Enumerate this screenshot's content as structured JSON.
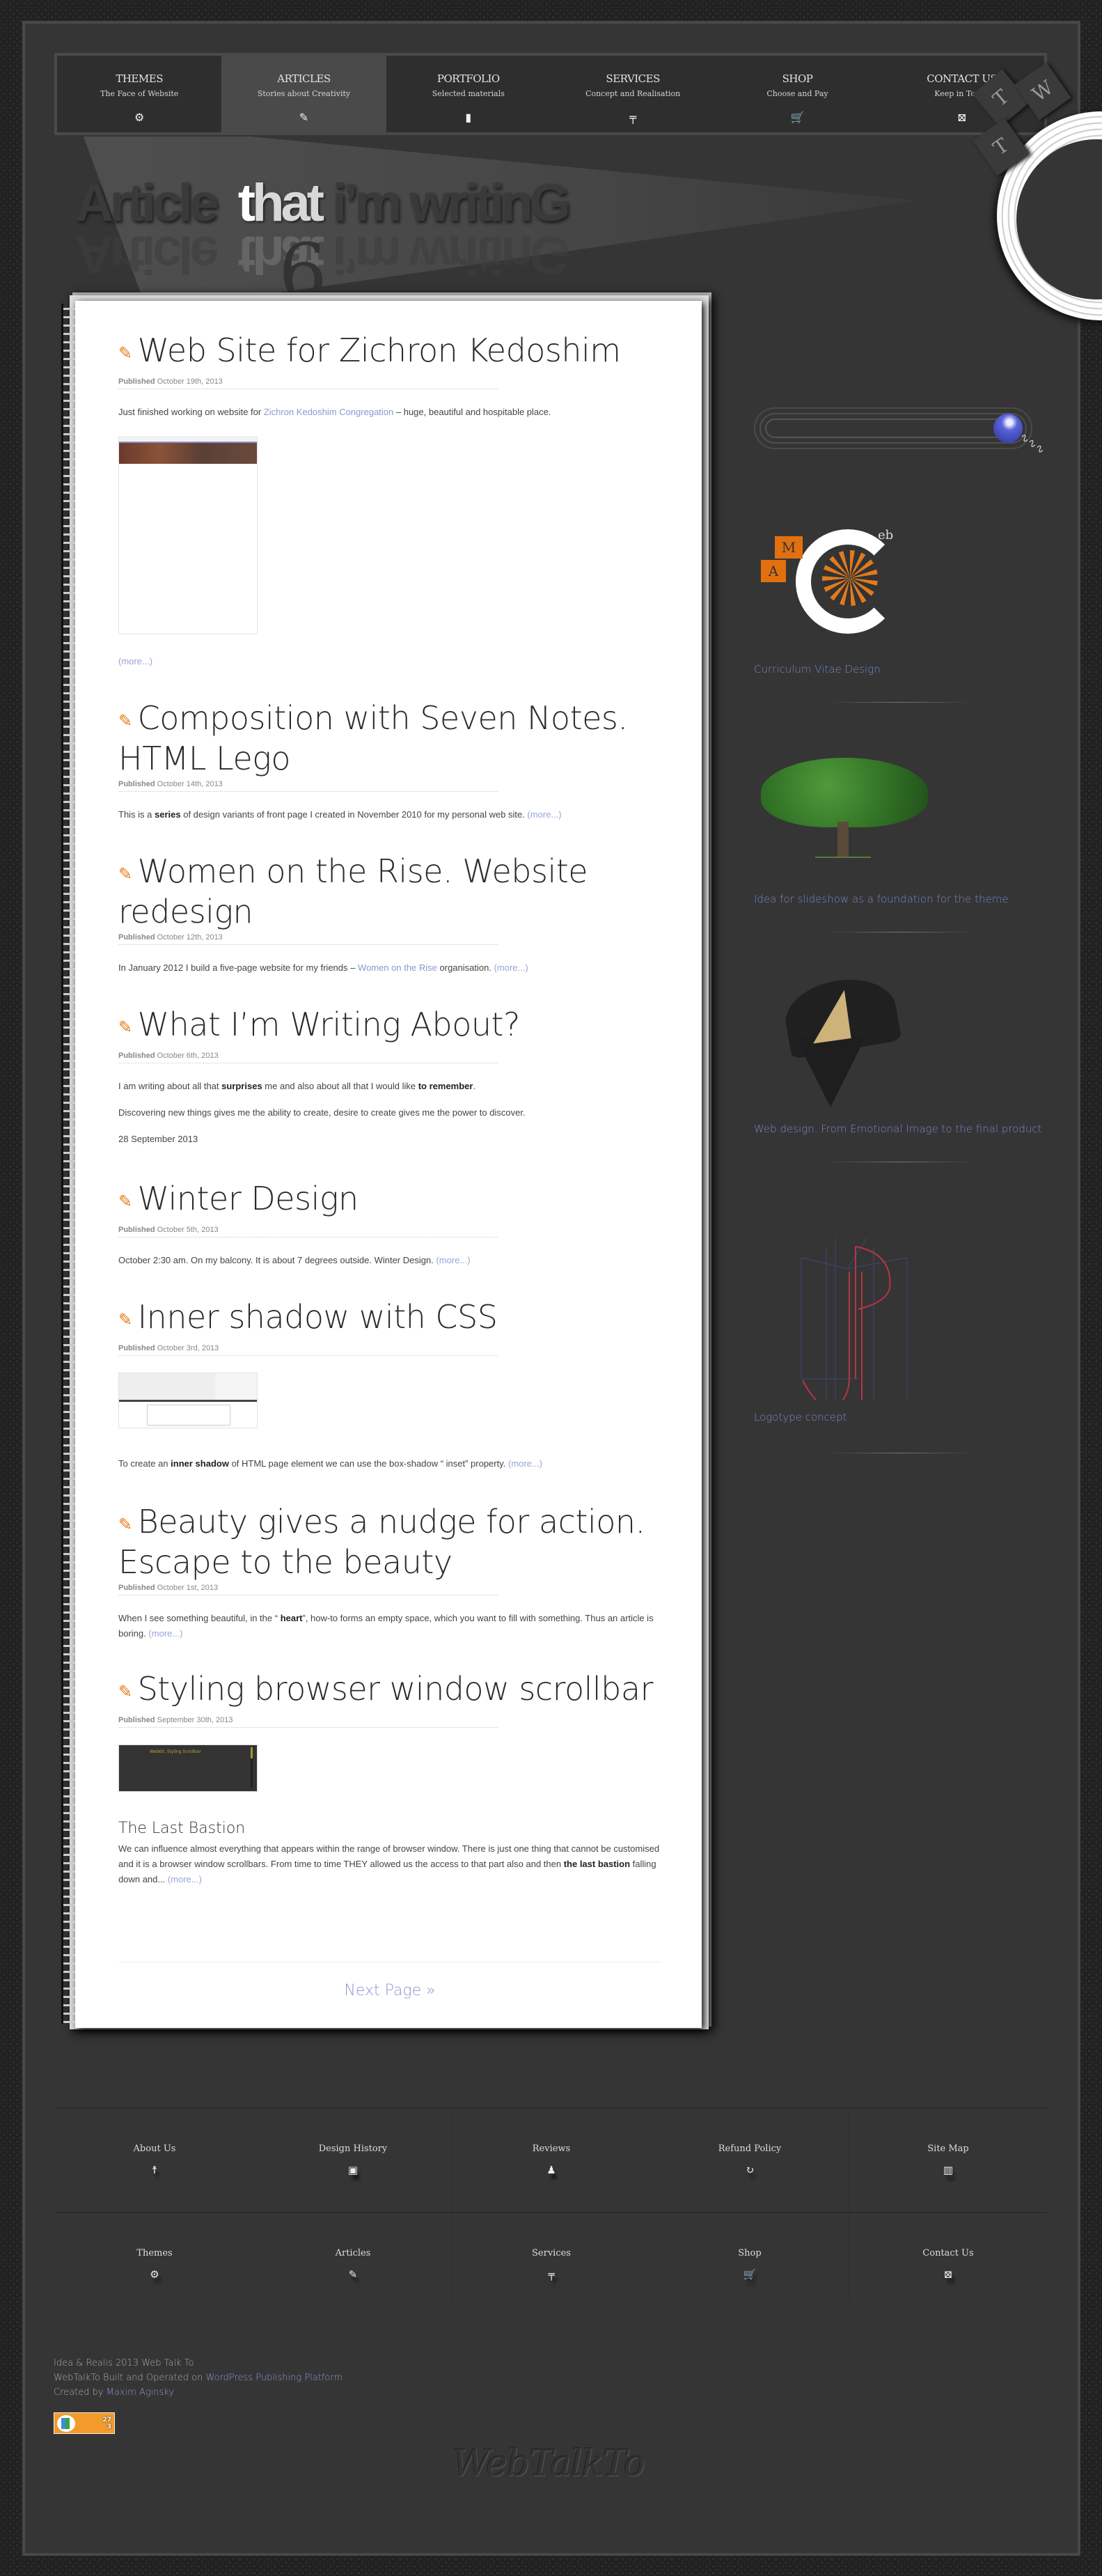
{
  "nav": {
    "items": [
      {
        "title": "THEMES",
        "subtitle": "The Face of Website",
        "icon": "⚙"
      },
      {
        "title": "ARTICLES",
        "subtitle": "Stories about Creativity",
        "icon": "✎"
      },
      {
        "title": "PORTFOLIO",
        "subtitle": "Selected materials",
        "icon": "▮"
      },
      {
        "title": "SERVICES",
        "subtitle": "Concept and Realisation",
        "icon": "╤"
      },
      {
        "title": "SHOP",
        "subtitle": "Choose and Pay",
        "icon": "🛒"
      },
      {
        "title": "CONTACT US",
        "subtitle": "Keep in Touch",
        "icon": "⊠"
      }
    ],
    "active_index": 1
  },
  "hero": {
    "before": "Article",
    "highlight_first": "t",
    "highlight_rest": "hat",
    "after": "i’m writinG",
    "reflect_mark": "6"
  },
  "clock": {
    "cards": [
      "T",
      "W",
      "T"
    ]
  },
  "posts": [
    {
      "title": "Web Site for Zichron Kedoshim",
      "published_label": "Published",
      "date": "October 19th, 2013",
      "text_before": "Just finished working on website for ",
      "link": "Zichron Kedoshim Congregation",
      "text_after": " – huge, beautiful and hospitable place.",
      "more": "(more...)"
    },
    {
      "title": "Composition with Seven Notes. HTML Lego",
      "published_label": "Published",
      "date": "October 14th, 2013",
      "text_before": "This is a ",
      "bold": "series",
      "text_after": " of design variants of front page I created in November 2010 for my personal web site. ",
      "more": "(more...)"
    },
    {
      "title": "Women on the Rise. Website redesign",
      "published_label": "Published",
      "date": "October 12th, 2013",
      "text_before": "In January 2012 I build a five-page website for my friends – ",
      "link": "Women on the Rise",
      "text_after": " organisation. ",
      "more": "(more...)"
    },
    {
      "title": "What I’m Writing About?",
      "published_label": "Published",
      "date": "October 6th, 2013",
      "p1_a": "I am writing about all that ",
      "p1_b1": "surprises",
      "p1_c": " me and also about all that I would like ",
      "p1_b2": "to remember",
      "p1_d": ".",
      "p2": "Discovering new things gives me the ability to create, desire to create gives me the power to discover.",
      "p3": "28 September 2013"
    },
    {
      "title": "Winter Design",
      "published_label": "Published",
      "date": "October 5th, 2013",
      "text": "October 2:30 am. On my balcony. It is about 7 degrees outside. Winter Design. ",
      "more": "(more...)"
    },
    {
      "title": "Inner shadow with CSS",
      "published_label": "Published",
      "date": "October 3rd, 2013",
      "text_before": "To create an ",
      "bold": "inner shadow",
      "text_after": " of HTML page element we can use the box-shadow “ inset” property. ",
      "more": "(more...)"
    },
    {
      "title": "Beauty gives a nudge for action. Escape to the beauty",
      "published_label": "Published",
      "date": "October 1st, 2013",
      "text_before": "When I see something beautiful, in the “ ",
      "bold": "heart",
      "text_after": "”, how-to forms an empty space, which you want to fill with something. Thus an article is boring. ",
      "more": "(more...)"
    },
    {
      "title": "Styling browser window scrollbar",
      "published_label": "Published",
      "date": "September 30th, 2013",
      "subheading": "The Last Bastion",
      "text_before": "We can influence almost everything that appears within the range of browser window. There is just one thing that cannot be customised and it is a browser window scrollbars. From time to time THEY allowed us the access to that part also and then ",
      "bold": "the last bastion",
      "text_after": " falling down and... ",
      "more": "(more...)",
      "thumb_text": "WebKit, Styling Scrollbar"
    }
  ],
  "pagination": {
    "next": "Next Page »"
  },
  "sidebar": {
    "search": {
      "placeholder": "",
      "value": ""
    },
    "widgets": [
      {
        "caption": "Curriculum Vitae Design",
        "logo_letters": [
          "M",
          "A"
        ],
        "logo_suffix": "eb"
      },
      {
        "caption": "Idea for slideshow as a foundation for the theme"
      },
      {
        "caption": "Web design. From Emotional Image to the final product"
      },
      {
        "caption": "Logotype concept"
      }
    ]
  },
  "footer": {
    "row1": [
      {
        "label": "About Us",
        "icon": "☨"
      },
      {
        "label": "Design History",
        "icon": "▣"
      },
      {
        "label": "Reviews",
        "icon": "♟"
      },
      {
        "label": "Refund Policy",
        "icon": "↻"
      },
      {
        "label": "Site Map",
        "icon": "▥"
      }
    ],
    "row2": [
      {
        "label": "Themes",
        "icon": "⚙"
      },
      {
        "label": "Articles",
        "icon": "✎"
      },
      {
        "label": "Services",
        "icon": "╤"
      },
      {
        "label": "Shop",
        "icon": "🛒"
      },
      {
        "label": "Contact Us",
        "icon": "⊠"
      }
    ],
    "credits": {
      "line1": "Idea & Realis 2013 Web Talk To",
      "line2_text": "WebTalkTo Built and Operated on ",
      "line2_link": "WordPress Publishing Platform",
      "line3_text": "Created by ",
      "line3_link": "Maxim Aginsky"
    },
    "counter": {
      "top": "27",
      "bottom": "3"
    },
    "signature": "WebTalkTo"
  },
  "colors": {
    "accent": "#e87a12",
    "link": "#8a97d2",
    "caption": "#7784c8",
    "background": "#353535"
  }
}
